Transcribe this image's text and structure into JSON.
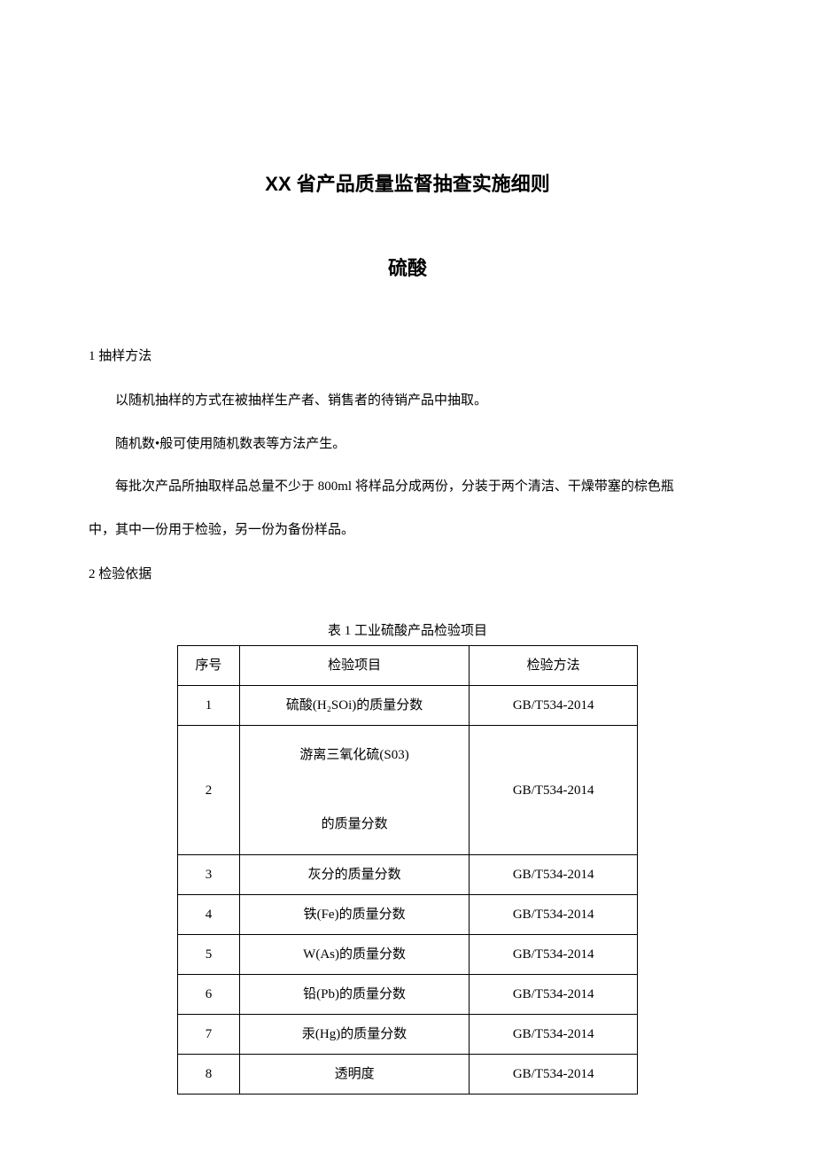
{
  "title": "XX 省产品质量监督抽查实施细则",
  "subtitle": "硫酸",
  "section1": {
    "heading": "1 抽样方法",
    "p1": "以随机抽样的方式在被抽样生产者、销售者的待销产品中抽取。",
    "p2": "随机数•般可使用随机数表等方法产生。",
    "p3a": "每批次产品所抽取样品总量不少于 800ml 将样品分成两份，分装于两个清洁、干燥带塞的棕色瓶",
    "p3b": "中，其中一份用于检验，另一份为备份样品。"
  },
  "section2": {
    "heading": "2 检验依据",
    "tableCaption": "表 1 工业硫酸产品检验项目",
    "headers": {
      "index": "序号",
      "item": "检验项目",
      "method": "检验方法"
    },
    "rows": [
      {
        "index": "1",
        "item": "硫酸(H₂SOi)的质量分数",
        "method": "GB/T534-2014"
      },
      {
        "index": "2",
        "item_line1": "游离三氧化硫(S03)",
        "item_line2": "的质量分数",
        "method": "GB/T534-2014"
      },
      {
        "index": "3",
        "item": "灰分的质量分数",
        "method": "GB/T534-2014"
      },
      {
        "index": "4",
        "item": "铁(Fe)的质量分数",
        "method": "GB/T534-2014"
      },
      {
        "index": "5",
        "item": "W(As)的质量分数",
        "method": "GB/T534-2014"
      },
      {
        "index": "6",
        "item": "铅(Pb)的质量分数",
        "method": "GB/T534-2014"
      },
      {
        "index": "7",
        "item": "汞(Hg)的质量分数",
        "method": "GB/T534-2014"
      },
      {
        "index": "8",
        "item": "透明度",
        "method": "GB/T534-2014"
      }
    ]
  }
}
